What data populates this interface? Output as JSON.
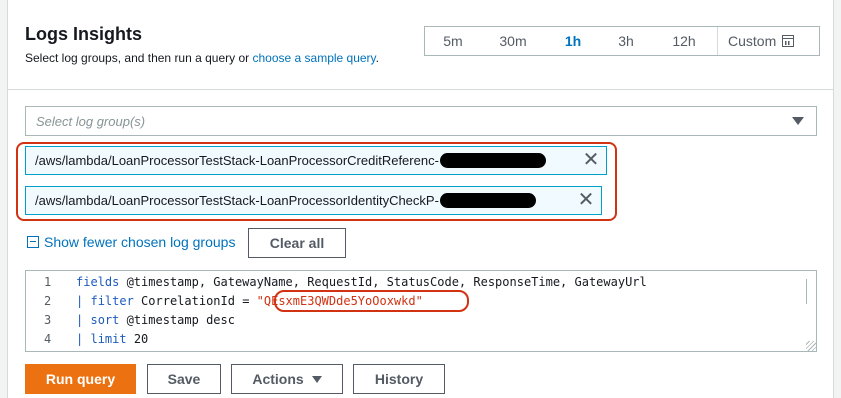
{
  "header": {
    "title": "Logs Insights",
    "subtitle_prefix": "Select log groups, and then run a query or ",
    "subtitle_link": "choose a sample query",
    "subtitle_suffix": "."
  },
  "time_range": {
    "options": [
      "5m",
      "30m",
      "1h",
      "3h",
      "12h"
    ],
    "selected": "1h",
    "custom_label": "Custom"
  },
  "log_group_select": {
    "placeholder": "Select log group(s)"
  },
  "chosen_log_groups": [
    "/aws/lambda/LoanProcessorTestStack-LoanProcessorCreditReferenc-",
    "/aws/lambda/LoanProcessorTestStack-LoanProcessorIdentityCheckP-"
  ],
  "show_fewer_label": "Show fewer chosen log groups",
  "clear_all_label": "Clear all",
  "query": {
    "line_numbers": [
      "1",
      "2",
      "3",
      "4"
    ],
    "line1_kw": "fields",
    "line1_rest": " @timestamp, GatewayName, RequestId, StatusCode, ResponseTime, GatewayUrl",
    "line2_pipe": "|",
    "line2_kw": "filter",
    "line2_field": " CorrelationId = ",
    "line2_str": "\"QEsxmE3QWDde5YoOoxwkd\"",
    "line3_pipe": "|",
    "line3_kw": "sort",
    "line3_rest": " @timestamp desc",
    "line4_pipe": "|",
    "line4_kw": "limit",
    "line4_rest": " 20"
  },
  "actions": {
    "run_query": "Run query",
    "save": "Save",
    "actions": "Actions",
    "history": "History"
  },
  "colors": {
    "accent": "#0073bb",
    "primary_button": "#ec7211",
    "annotation": "#d13212"
  }
}
